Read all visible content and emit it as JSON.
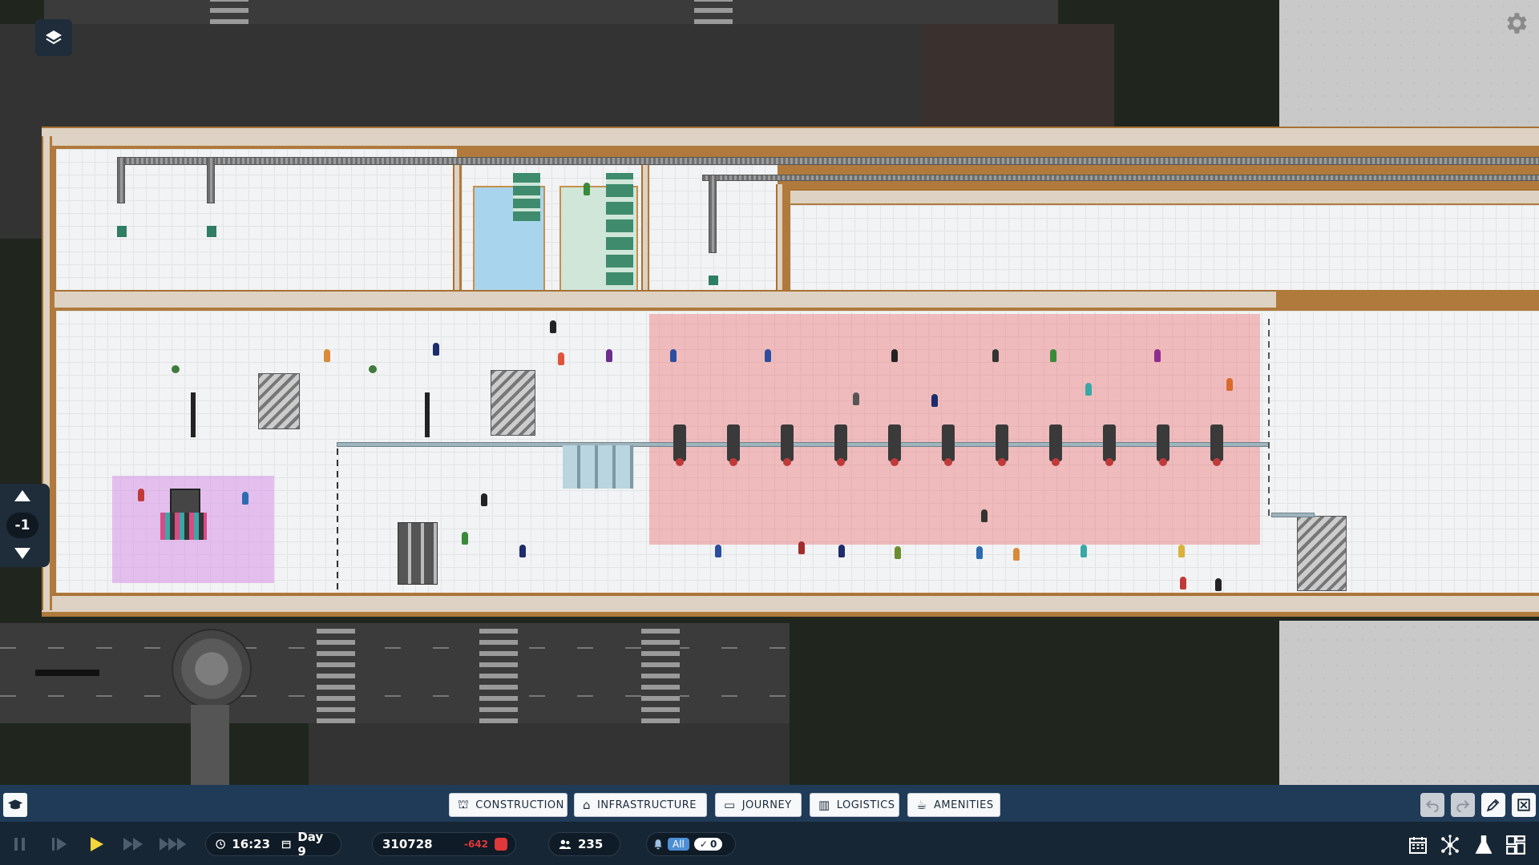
{
  "toolbar": {
    "categories": [
      {
        "label": "CONSTRUCTION",
        "icon": "crane-icon"
      },
      {
        "label": "INFRASTRUCTURE",
        "icon": "building-icon"
      },
      {
        "label": "JOURNEY",
        "icon": "ticket-icon"
      },
      {
        "label": "LOGISTICS",
        "icon": "trash-icon"
      },
      {
        "label": "AMENITIES",
        "icon": "coffee-icon"
      }
    ]
  },
  "status": {
    "time": "16:23",
    "day": "Day 9",
    "money": "310728",
    "money_delta": "-642",
    "passengers": "235",
    "filter_label": "All",
    "check_count": "0"
  },
  "floor": {
    "level": "-1"
  },
  "colors": {
    "accent": "#f3d53b",
    "toolbar": "#1f3b57",
    "negative": "#e0383a",
    "security_zone": "#ee8c8c",
    "pink_zone": "#d88ce6"
  }
}
